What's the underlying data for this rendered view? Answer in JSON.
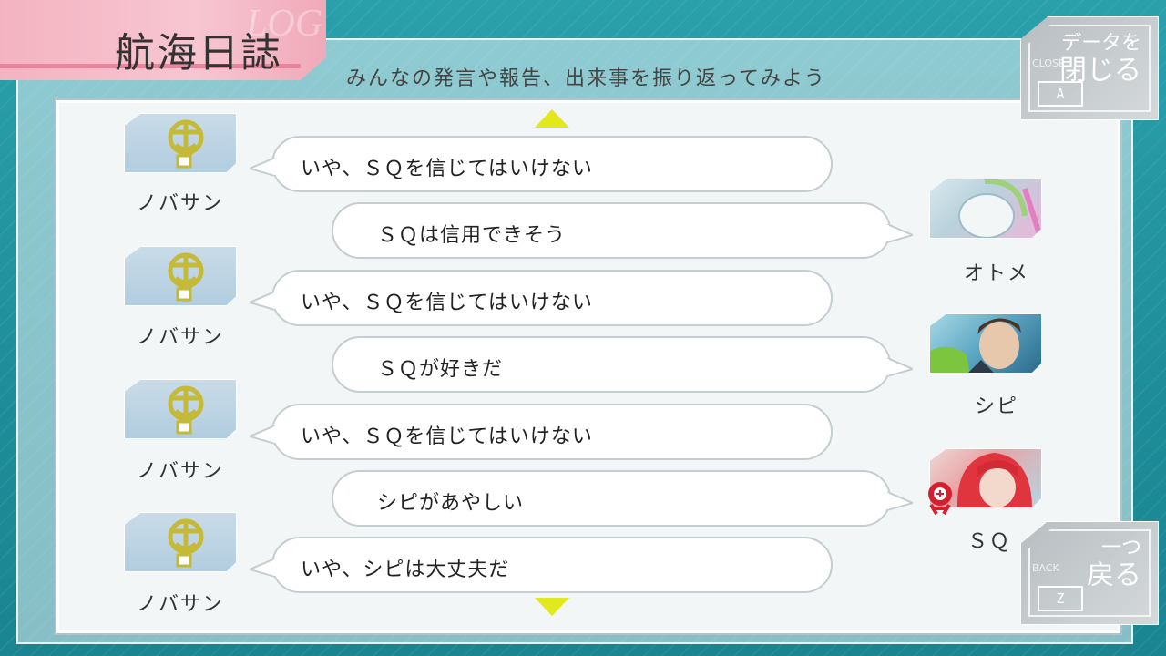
{
  "header": {
    "title": "航海日誌",
    "title_ghost": "LOG",
    "subtitle": "みんなの発言や報告、出来事を振り返ってみよう"
  },
  "close_button": {
    "label_top": "データを",
    "label_bottom": "閉じる",
    "small": "CLOSE",
    "key": "A"
  },
  "back_button": {
    "label_top": "一つ",
    "label_bottom": "戻る",
    "small": "BACK",
    "key": "Z"
  },
  "log": [
    {
      "speaker": "ノバサン",
      "side": "left",
      "text": "いや、ＳＱを信じてはいけない"
    },
    {
      "speaker": "オトメ",
      "side": "right",
      "text": "ＳＱは信用できそう"
    },
    {
      "speaker": "ノバサン",
      "side": "left",
      "text": "いや、ＳＱを信じてはいけない"
    },
    {
      "speaker": "シピ",
      "side": "right",
      "text": "ＳＱが好きだ"
    },
    {
      "speaker": "ノバサン",
      "side": "left",
      "text": "いや、ＳＱを信じてはいけない"
    },
    {
      "speaker": "ＳＱ",
      "side": "right",
      "text": "シピがあやしい"
    },
    {
      "speaker": "ノバサン",
      "side": "left",
      "text": "いや、シピは大丈夫だ"
    }
  ],
  "colors": {
    "background": "#1e8d99",
    "title_tab": "#f4b3c1",
    "arrow": "#e2e81c",
    "emblem": "#c5b938"
  },
  "icons": [
    "scroll-up-icon",
    "scroll-down-icon",
    "nobasan-emblem-icon",
    "sq-skull-badge-icon"
  ]
}
